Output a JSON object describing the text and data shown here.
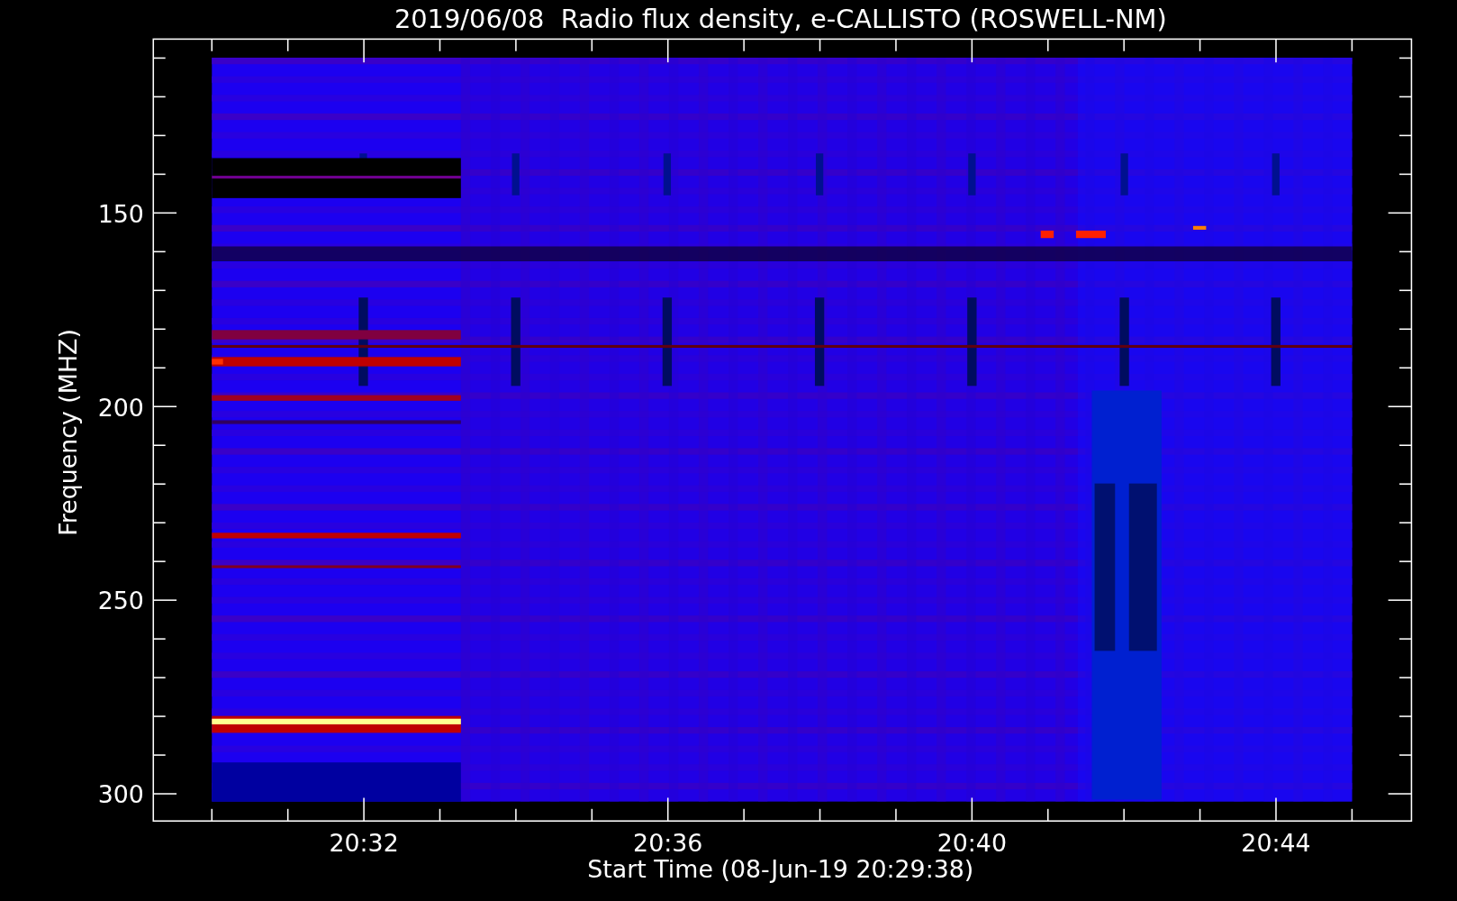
{
  "title": "2019/06/08  Radio flux density, e-CALLISTO (ROSWELL-NM)",
  "y_axis": {
    "label": "Frequency (MHZ)",
    "ticks": [
      "150",
      "200",
      "250",
      "300"
    ]
  },
  "x_axis": {
    "label": "Start Time (08-Jun-19 20:29:38)",
    "ticks": [
      "20:32",
      "20:36",
      "20:40",
      "20:44"
    ]
  }
}
